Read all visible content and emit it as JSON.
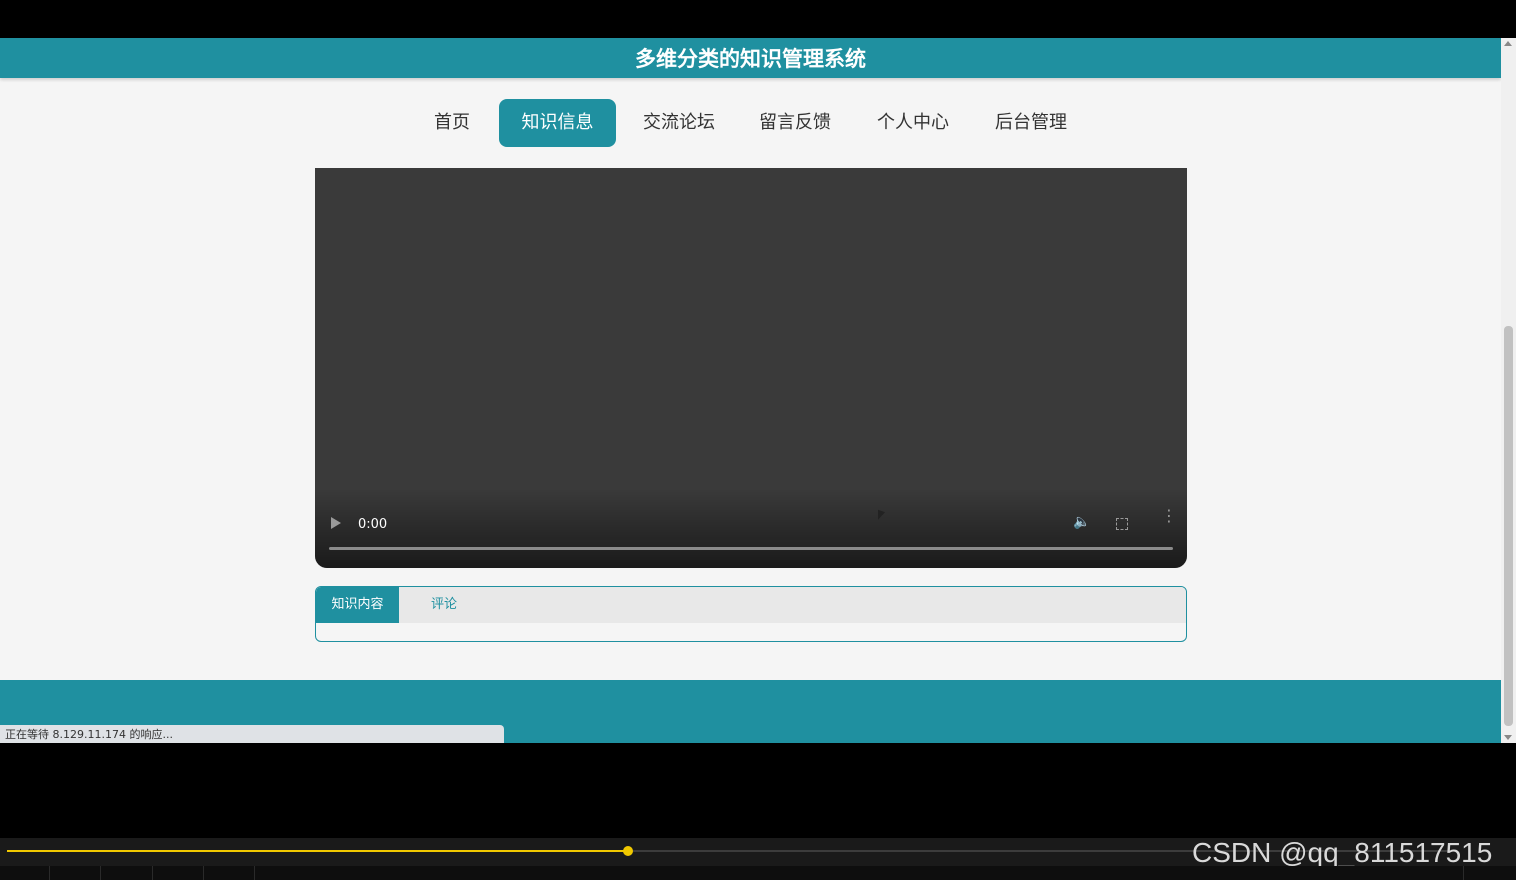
{
  "header": {
    "title": "多维分类的知识管理系统"
  },
  "nav": {
    "items": [
      {
        "label": "首页",
        "active": false
      },
      {
        "label": "知识信息",
        "active": true
      },
      {
        "label": "交流论坛",
        "active": false
      },
      {
        "label": "留言反馈",
        "active": false
      },
      {
        "label": "个人中心",
        "active": false
      },
      {
        "label": "后台管理",
        "active": false
      }
    ]
  },
  "video": {
    "time": "0:00",
    "icons": [
      "play-icon",
      "volume-icon",
      "fullscreen-icon",
      "more-icon"
    ],
    "played_fraction": 0
  },
  "tabs": {
    "items": [
      {
        "label": "知识内容",
        "active": true
      },
      {
        "label": "评论",
        "active": false
      }
    ]
  },
  "status": {
    "text": "正在等待 8.129.11.174 的响应..."
  },
  "player": {
    "watermark": "CSDN @qq_811517515",
    "played_fraction": 0.43
  },
  "colors": {
    "accent": "#1f90a0",
    "background": "#f5f5f5",
    "seek": "#f0c800"
  }
}
